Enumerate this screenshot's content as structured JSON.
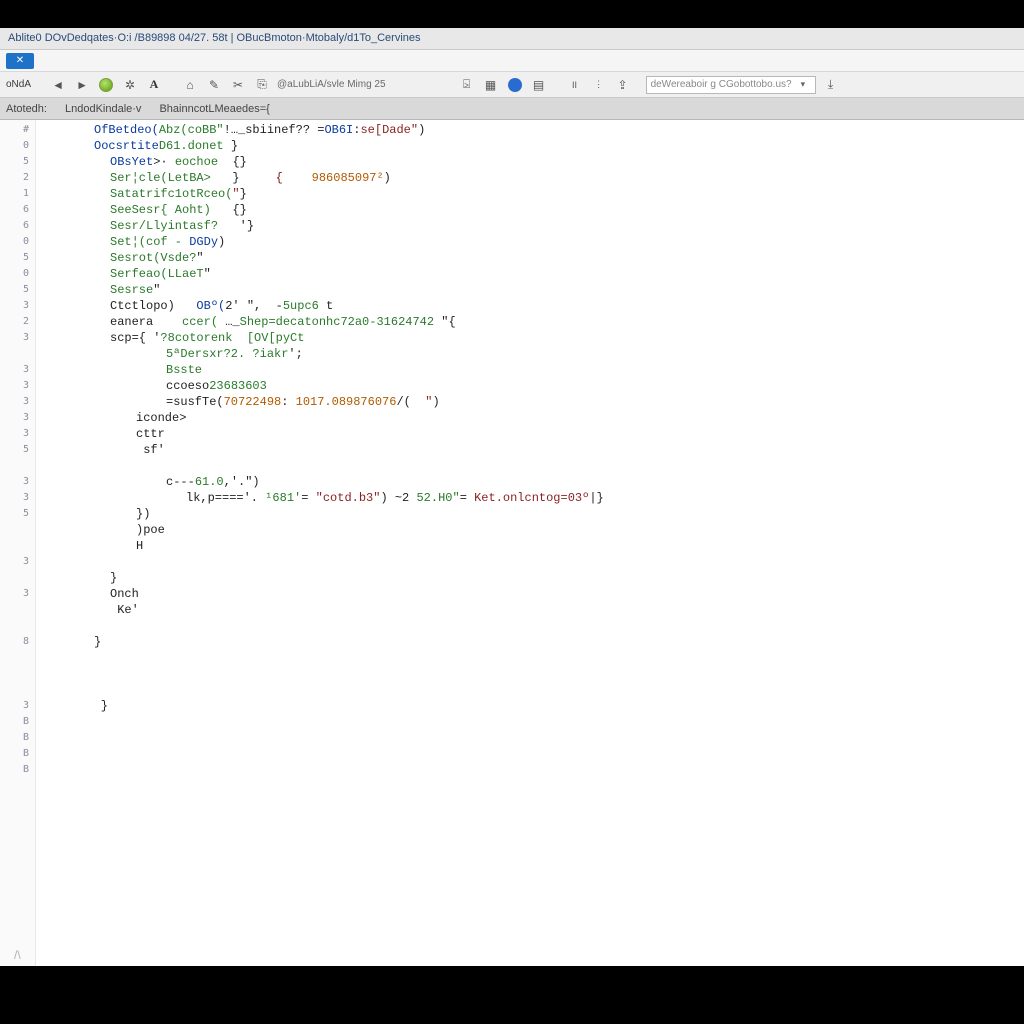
{
  "window": {
    "title": "Ablite0 DOvDedqates·O:i /B89898 04/27. 58t | OBucBmoton·Mtobaly/d1To_Cervines"
  },
  "badge": {
    "label": "✕"
  },
  "toolbar": {
    "left_label": "oNdA",
    "mid_text": "@aLubLiA/svle Mimg 25",
    "search_placeholder": "deWereaboir g CGobottobo.us?"
  },
  "tabs": {
    "t0": "Atotedh:",
    "t1": "LndodKindale·v",
    "t2": "BhainncotLMeaedes={"
  },
  "code": {
    "gutter": [
      "#",
      "0",
      "5",
      "2",
      "1",
      "6",
      "6",
      "0",
      "5",
      "0",
      "5",
      "3",
      "2",
      "3",
      "",
      "3",
      "3",
      "3",
      "3",
      "3",
      "5",
      "",
      "3",
      "3",
      "5",
      "",
      "",
      "3",
      "",
      "3",
      "",
      "",
      "8",
      "",
      "",
      "",
      "3",
      "B",
      "B",
      "B",
      "B"
    ],
    "lines": [
      {
        "indent": "pad1",
        "segs": [
          {
            "c": "kw",
            "t": "OfBetdeo("
          },
          {
            "c": "id",
            "t": "Abz(coBB\""
          },
          {
            "c": "pun",
            "t": "!…_sbiinef?? ="
          },
          {
            "c": "kw",
            "t": "OB6I"
          },
          {
            "c": "pun",
            "t": ":"
          },
          {
            "c": "str",
            "t": "se[Dade\""
          },
          {
            "c": "pun",
            "t": ")"
          }
        ]
      },
      {
        "indent": "pad1",
        "segs": [
          {
            "c": "kw",
            "t": "Oocsrtite"
          },
          {
            "c": "id",
            "t": "D61.donet"
          },
          {
            "c": "pun",
            "t": " }"
          }
        ]
      },
      {
        "indent": "pad2",
        "segs": [
          {
            "c": "kw",
            "t": "OBsYet"
          },
          {
            "c": "pun",
            "t": ">· "
          },
          {
            "c": "id",
            "t": "eochoe"
          },
          {
            "c": "pun",
            "t": "  {}"
          }
        ]
      },
      {
        "indent": "pad2",
        "segs": [
          {
            "c": "id",
            "t": "Ser¦cle("
          },
          {
            "c": "id",
            "t": "LetBA>"
          },
          {
            "c": "pun",
            "t": "   }     "
          },
          {
            "c": "brace",
            "t": "{"
          },
          {
            "c": "pun",
            "t": "    "
          },
          {
            "c": "num",
            "t": "986085097²"
          },
          {
            "c": "pun",
            "t": ")"
          }
        ]
      },
      {
        "indent": "pad2",
        "segs": [
          {
            "c": "id",
            "t": "Satatrifc1otRceo("
          },
          {
            "c": "str",
            "t": "\""
          },
          {
            "c": "pun",
            "t": "}"
          }
        ]
      },
      {
        "indent": "pad2",
        "segs": [
          {
            "c": "id",
            "t": "SeeSesr{ Aoht)"
          },
          {
            "c": "pun",
            "t": "   {}"
          }
        ]
      },
      {
        "indent": "pad2",
        "segs": [
          {
            "c": "id",
            "t": "Sesr/Llyintasf?"
          },
          {
            "c": "pun",
            "t": "   '}"
          }
        ]
      },
      {
        "indent": "pad2",
        "segs": [
          {
            "c": "id",
            "t": "Set¦(cof - "
          },
          {
            "c": "kw",
            "t": "DGDy"
          },
          {
            "c": "pun",
            "t": ")"
          }
        ]
      },
      {
        "indent": "pad2",
        "segs": [
          {
            "c": "id",
            "t": "Sesrot(Vsde?"
          },
          {
            "c": "pun",
            "t": "\""
          }
        ]
      },
      {
        "indent": "pad2",
        "segs": [
          {
            "c": "id",
            "t": "Serfeao("
          },
          {
            "c": "id",
            "t": "LLaeT"
          },
          {
            "c": "pun",
            "t": "\""
          }
        ]
      },
      {
        "indent": "pad2",
        "segs": [
          {
            "c": "id",
            "t": "Sesrse"
          },
          {
            "c": "pun",
            "t": "\""
          }
        ]
      },
      {
        "indent": "pad2",
        "segs": [
          {
            "c": "pun",
            "t": "Ctctlopo)   "
          },
          {
            "c": "kw",
            "t": "OBº("
          },
          {
            "c": "pun",
            "t": "2' \",  -"
          },
          {
            "c": "id",
            "t": "5upc6"
          },
          {
            "c": "pun",
            "t": " t"
          }
        ]
      },
      {
        "indent": "pad2",
        "segs": [
          {
            "c": "pun",
            "t": "eanera    "
          },
          {
            "c": "id",
            "t": "ccer("
          },
          {
            "c": "pun",
            "t": " …_"
          },
          {
            "c": "id",
            "t": "Shep=decatonhc72a0-31624742"
          },
          {
            "c": "pun",
            "t": " \"{"
          }
        ]
      },
      {
        "indent": "pad2",
        "segs": [
          {
            "c": "pun",
            "t": "scp={ '"
          },
          {
            "c": "id",
            "t": "?8cotorenk  [OV[pyCt"
          }
        ]
      },
      {
        "indent": "pad4",
        "segs": [
          {
            "c": "id",
            "t": "5ªDersxr?2. ?iakr"
          },
          {
            "c": "pun",
            "t": "';"
          }
        ]
      },
      {
        "indent": "pad4",
        "segs": [
          {
            "c": "id",
            "t": "Bsste"
          }
        ]
      },
      {
        "indent": "pad4",
        "segs": [
          {
            "c": "pun",
            "t": "ccoeso"
          },
          {
            "c": "id",
            "t": "23683603"
          }
        ]
      },
      {
        "indent": "pad4",
        "segs": [
          {
            "c": "pun",
            "t": "=susfTe("
          },
          {
            "c": "num",
            "t": "70722498"
          },
          {
            "c": "pun",
            "t": ": "
          },
          {
            "c": "num",
            "t": "1017.089876076"
          },
          {
            "c": "pun",
            "t": "/(  "
          },
          {
            "c": "str",
            "t": "\""
          },
          {
            "c": "pun",
            "t": ")"
          }
        ]
      },
      {
        "indent": "pad3",
        "segs": [
          {
            "c": "pun",
            "t": "iconde>"
          }
        ]
      },
      {
        "indent": "pad3",
        "segs": [
          {
            "c": "pun",
            "t": "cttr"
          }
        ]
      },
      {
        "indent": "pad3",
        "segs": [
          {
            "c": "pun",
            "t": " sf'"
          }
        ]
      },
      {
        "indent": "pad3",
        "segs": [
          {
            "c": "pun",
            "t": ""
          }
        ]
      },
      {
        "indent": "pad4",
        "segs": [
          {
            "c": "pun",
            "t": "c---"
          },
          {
            "c": "id",
            "t": "61.0"
          },
          {
            "c": "pun",
            "t": ",'.\")"
          }
        ]
      },
      {
        "indent": "pad5",
        "segs": [
          {
            "c": "pun",
            "t": "lk,p===='. "
          },
          {
            "c": "id",
            "t": "¹681'"
          },
          {
            "c": "pun",
            "t": "= "
          },
          {
            "c": "str",
            "t": "\"cotd.b3\""
          },
          {
            "c": "pun",
            "t": ") ~2 "
          },
          {
            "c": "id",
            "t": "52.H0\""
          },
          {
            "c": "pun",
            "t": "= "
          },
          {
            "c": "str",
            "t": "Ket.onlcntog=03º"
          },
          {
            "c": "pun",
            "t": "|}"
          }
        ]
      },
      {
        "indent": "pad3",
        "segs": [
          {
            "c": "pun",
            "t": "})"
          }
        ]
      },
      {
        "indent": "pad3",
        "segs": [
          {
            "c": "pun",
            "t": ")poe"
          }
        ]
      },
      {
        "indent": "pad3",
        "segs": [
          {
            "c": "pun",
            "t": "H"
          }
        ]
      },
      {
        "indent": "pad3",
        "segs": [
          {
            "c": "pun",
            "t": ""
          }
        ]
      },
      {
        "indent": "pad2",
        "segs": [
          {
            "c": "pun",
            "t": "}"
          }
        ]
      },
      {
        "indent": "pad2",
        "segs": [
          {
            "c": "pun",
            "t": "Onch"
          }
        ]
      },
      {
        "indent": "pad2",
        "segs": [
          {
            "c": "pun",
            "t": " Ke'"
          }
        ]
      },
      {
        "indent": "pad1",
        "segs": [
          {
            "c": "pun",
            "t": ""
          }
        ]
      },
      {
        "indent": "pad1",
        "segs": [
          {
            "c": "pun",
            "t": "}"
          }
        ]
      },
      {
        "indent": "pad1",
        "segs": [
          {
            "c": "pun",
            "t": ""
          }
        ]
      },
      {
        "indent": "pad1",
        "segs": [
          {
            "c": "pun",
            "t": ""
          }
        ]
      },
      {
        "indent": "pad1",
        "segs": [
          {
            "c": "pun",
            "t": ""
          }
        ]
      },
      {
        "indent": "",
        "segs": [
          {
            "c": "pun",
            "t": "         }"
          }
        ]
      }
    ]
  },
  "bottom_glyph": "/\\"
}
